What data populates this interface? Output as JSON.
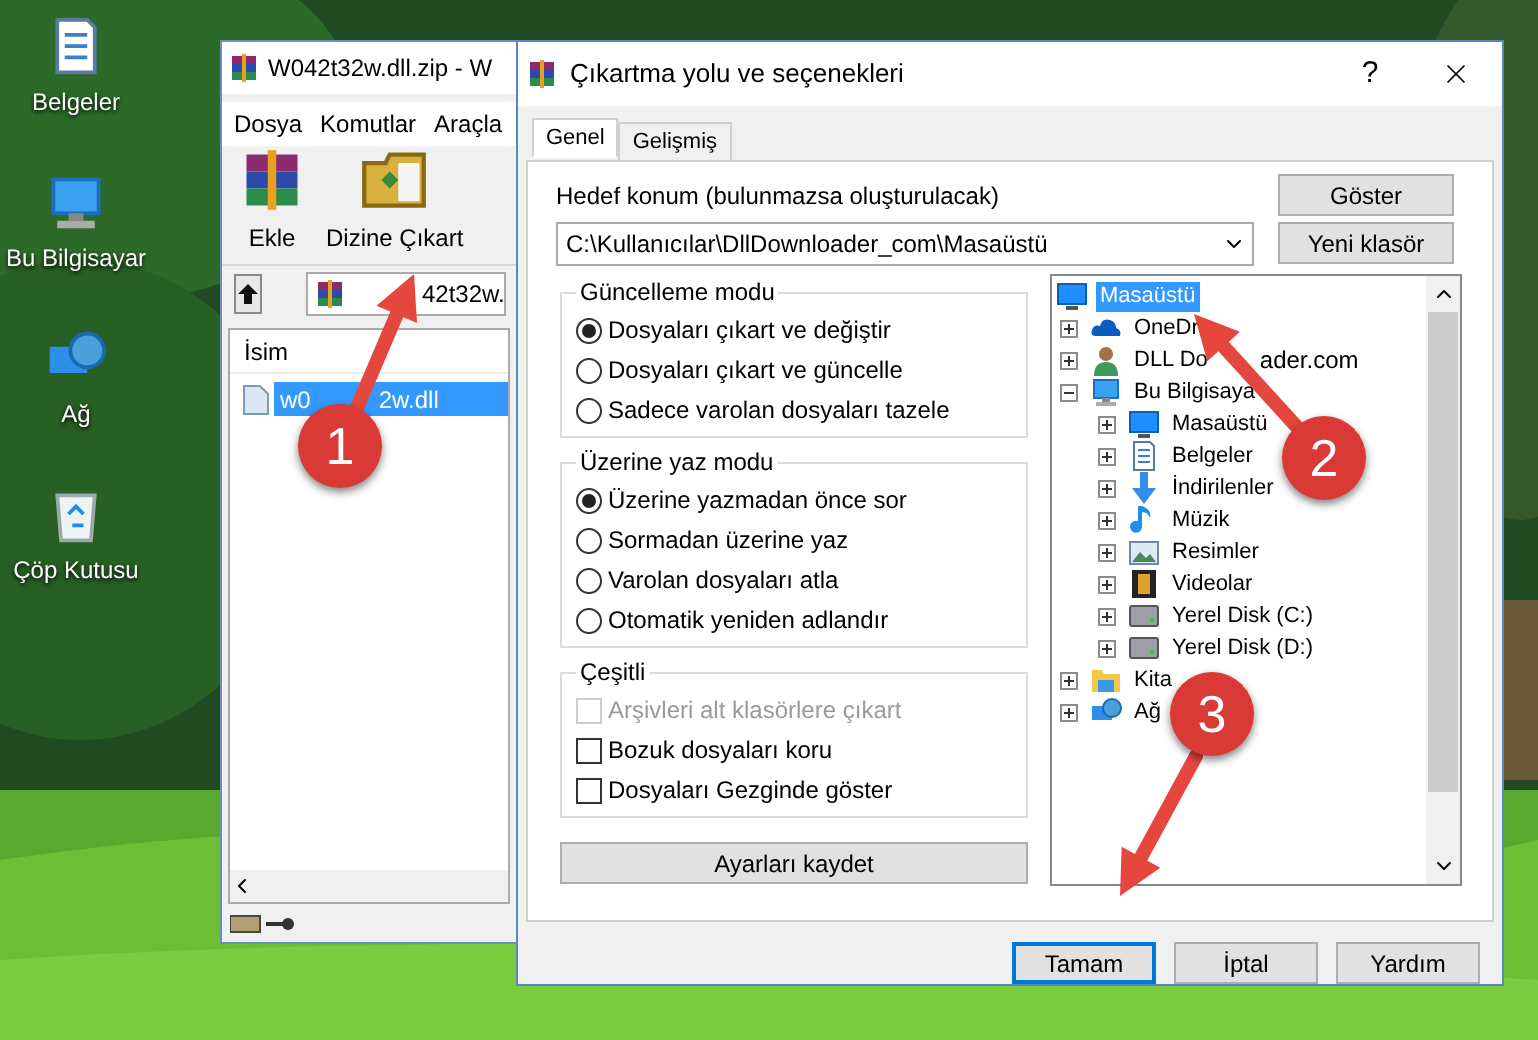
{
  "desktop_icons": [
    {
      "label": "Belgeler",
      "kind": "documents"
    },
    {
      "label": "Bu Bilgisayar",
      "kind": "computer"
    },
    {
      "label": "Ağ",
      "kind": "network"
    },
    {
      "label": "Çöp Kutusu",
      "kind": "recycle"
    }
  ],
  "archiver": {
    "title": "W042t32w.dll.zip - W",
    "menu": [
      "Dosya",
      "Komutlar",
      "Araçla"
    ],
    "toolbar": [
      {
        "label": "Ekle",
        "kind": "add"
      },
      {
        "label": "Dizine Çıkart",
        "kind": "extract"
      }
    ],
    "address": "42t32w.",
    "column": "İsim",
    "file": {
      "name": "w0",
      "name_tail": "2w.dll",
      "selected": true
    }
  },
  "dialog": {
    "title": "Çıkartma yolu ve seçenekleri",
    "help": "?",
    "tabs": [
      {
        "label": "Genel",
        "selected": true
      },
      {
        "label": "Gelişmiş",
        "selected": false
      }
    ],
    "destination_label": "Hedef konum (bulunmazsa oluşturulacak)",
    "destination": "C:\\Kullanıcılar\\DllDownloader_com\\Masaüstü",
    "side_buttons": [
      "Göster",
      "Yeni klasör"
    ],
    "groups": [
      {
        "title": "Güncelleme modu",
        "options": [
          {
            "kind": "radio",
            "label": "Dosyaları çıkart ve değiştir",
            "selected": true
          },
          {
            "kind": "radio",
            "label": "Dosyaları çıkart ve güncelle",
            "selected": false
          },
          {
            "kind": "radio",
            "label": "Sadece varolan dosyaları tazele",
            "selected": false
          }
        ]
      },
      {
        "title": "Üzerine yaz modu",
        "options": [
          {
            "kind": "radio",
            "label": "Üzerine yazmadan önce sor",
            "selected": true
          },
          {
            "kind": "radio",
            "label": "Sormadan üzerine yaz",
            "selected": false
          },
          {
            "kind": "radio",
            "label": "Varolan dosyaları atla",
            "selected": false
          },
          {
            "kind": "radio",
            "label": "Otomatik yeniden adlandır",
            "selected": false
          }
        ]
      },
      {
        "title": "Çeşitli",
        "options": [
          {
            "kind": "checkbox",
            "label": "Arşivleri alt klasörlere çıkart",
            "checked": false,
            "disabled": true
          },
          {
            "kind": "checkbox",
            "label": "Bozuk dosyaları koru",
            "checked": false,
            "disabled": false
          },
          {
            "kind": "checkbox",
            "label": "Dosyaları Gezginde göster",
            "checked": false,
            "disabled": false
          }
        ]
      }
    ],
    "save_button": "Ayarları kaydet",
    "tree": [
      {
        "label": "Masaüstü",
        "kind": "desktop",
        "selected": true,
        "children": [
          {
            "label": "OneDr",
            "kind": "cloud",
            "expanded": false,
            "selected": false
          },
          {
            "label": "DLL Do",
            "tail": "ader.com",
            "kind": "user",
            "expanded": false,
            "selected": false
          },
          {
            "label": "Bu Bilgisaya",
            "kind": "computer",
            "expanded": true,
            "selected": false,
            "children": [
              {
                "label": "Masaüstü",
                "kind": "desktop",
                "expanded": false,
                "selected": false
              },
              {
                "label": "Belgeler",
                "kind": "documents",
                "expanded": false,
                "selected": false
              },
              {
                "label": "İndirilenler",
                "kind": "download",
                "expanded": false,
                "selected": false
              },
              {
                "label": "Müzik",
                "kind": "music",
                "expanded": false,
                "selected": false
              },
              {
                "label": "Resimler",
                "kind": "pictures",
                "expanded": false,
                "selected": false
              },
              {
                "label": "Videolar",
                "kind": "videos",
                "expanded": false,
                "selected": false
              },
              {
                "label": "Yerel Disk (C:)",
                "kind": "drive",
                "expanded": false,
                "selected": false
              },
              {
                "label": "Yerel Disk (D:)",
                "kind": "drive",
                "expanded": false,
                "selected": false
              }
            ]
          },
          {
            "label": "Kita",
            "kind": "library",
            "expanded": false,
            "selected": false
          },
          {
            "label": "Ağ",
            "kind": "network",
            "expanded": false,
            "selected": false
          }
        ]
      }
    ],
    "buttons": [
      {
        "label": "Tamam",
        "default": true
      },
      {
        "label": "İptal",
        "default": false
      },
      {
        "label": "Yardım",
        "default": false
      }
    ]
  },
  "annotations": [
    {
      "number": "1"
    },
    {
      "number": "2"
    },
    {
      "number": "3"
    }
  ]
}
